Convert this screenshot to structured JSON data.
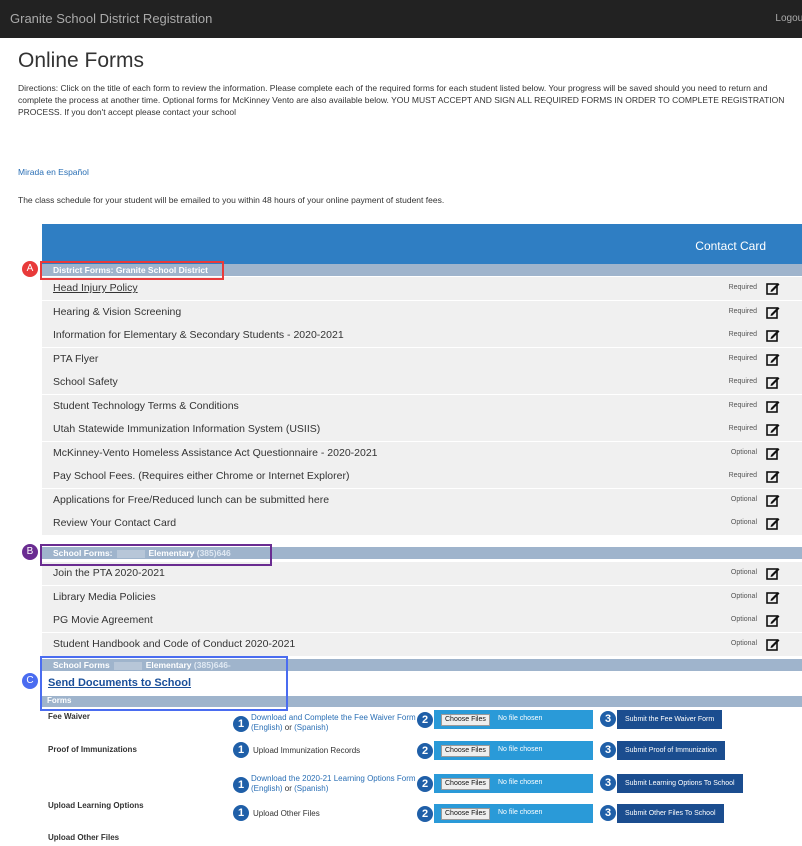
{
  "header": {
    "brand": "Granite School District Registration",
    "logout": "Logout"
  },
  "page_title": "Online Forms",
  "directions": "Directions: Click on the title of each form to review the information. Please complete each of the required forms for each student listed below. Your progress will be saved should you need to return and complete the process at another time. Optional forms for McKinney Vento are also available below. YOU MUST ACCEPT AND SIGN ALL REQUIRED FORMS IN ORDER TO COMPLETE REGISTRATION PROCESS.  If you don't accept please contact your school",
  "spanish_link": "Mirada en Español",
  "schedule_note": "The class schedule for your student will be emailed to you within 48 hours of your online payment of student fees.",
  "panel": {
    "contact_card": "Contact Card"
  },
  "district_section": {
    "title": "District Forms: Granite School District",
    "forms": [
      {
        "title": "Head Injury Policy",
        "status": "Required"
      },
      {
        "title": "Hearing & Vision Screening",
        "status": "Required"
      },
      {
        "title": "Information for Elementary & Secondary Students - 2020-2021",
        "status": "Required"
      },
      {
        "title": "PTA Flyer",
        "status": "Required"
      },
      {
        "title": "School Safety",
        "status": "Required"
      },
      {
        "title": "Student Technology Terms & Conditions",
        "status": "Required"
      },
      {
        "title": "Utah Statewide Immunization Information System (USIIS)",
        "status": "Required"
      },
      {
        "title": "McKinney-Vento Homeless Assistance Act Questionnaire - 2020-2021",
        "status": "Optional"
      },
      {
        "title": "Pay School Fees. (Requires either Chrome or Internet Explorer)",
        "status": "Required"
      },
      {
        "title": "Applications for Free/Reduced lunch can be submitted here",
        "status": "Optional"
      },
      {
        "title": "Review Your Contact Card",
        "status": "Optional"
      }
    ]
  },
  "school_section": {
    "prefix": "School Forms:",
    "school": "Elementary",
    "phone": "(385)646",
    "forms": [
      {
        "title": "Join the PTA 2020-2021",
        "status": "Optional"
      },
      {
        "title": "Library Media Policies",
        "status": "Optional"
      },
      {
        "title": "PG Movie Agreement",
        "status": "Optional"
      },
      {
        "title": "Student Handbook and Code of Conduct 2020-2021",
        "status": "Optional"
      }
    ]
  },
  "school_section_2": {
    "prefix": "School Forms",
    "school": "Elementary",
    "phone": "(385)646-"
  },
  "markers": {
    "a": "A",
    "b": "B",
    "c": "C"
  },
  "send_documents": "Send Documents to School",
  "forms_header": "Forms",
  "upload_rows": [
    {
      "label": "Fee Waiver",
      "step1_pre": "Download and Complete the Fee Waiver Form (English)",
      "step1_or": " or ",
      "step1_alt": "(Spanish)",
      "choose": "Choose Files",
      "no_file": "No file chosen",
      "submit": "Submit the Fee Waiver Form"
    },
    {
      "label": "Proof of Immunizations",
      "step1_text": "Upload Immunization Records",
      "choose": "Choose Files",
      "no_file": "No file chosen",
      "submit": "Submit Proof of Immunization"
    },
    {
      "label": "Upload Learning Options",
      "step1_pre": "Download the 2020-21 Learning Options Form (English)",
      "step1_or": " or ",
      "step1_alt": "(Spanish)",
      "choose": "Choose Files",
      "no_file": "No file chosen",
      "submit": "Submit Learning Options To School"
    },
    {
      "label": "Upload Other Files",
      "step1_text": "Upload Other Files",
      "choose": "Choose Files",
      "no_file": "No file chosen",
      "submit": "Submit Other Files To School"
    }
  ],
  "steps": {
    "one": "1",
    "two": "2",
    "three": "3"
  },
  "colors": {
    "marker_a": "#e83a3a",
    "marker_b": "#6a2c91",
    "marker_c": "#4a6cf0",
    "accent": "#2f7ec3"
  }
}
